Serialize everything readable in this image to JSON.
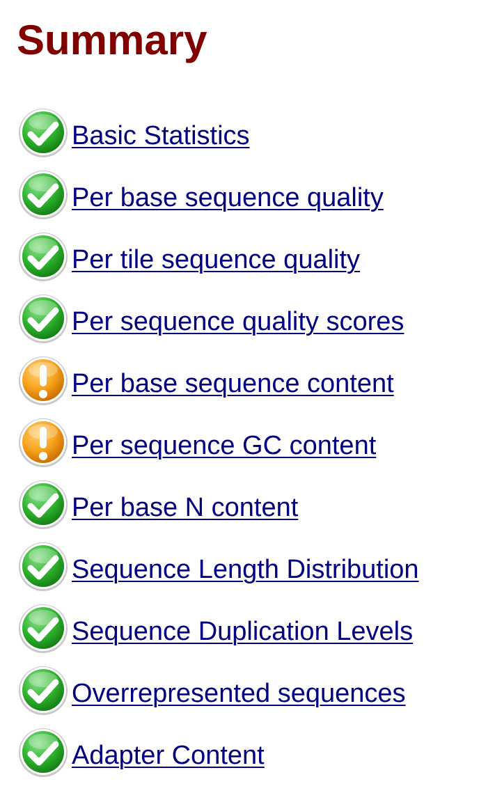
{
  "title": "Summary",
  "modules": [
    {
      "label": "Basic Statistics",
      "status": "pass",
      "icon": "pass-check-icon"
    },
    {
      "label": "Per base sequence quality",
      "status": "pass",
      "icon": "pass-check-icon"
    },
    {
      "label": "Per tile sequence quality",
      "status": "pass",
      "icon": "pass-check-icon"
    },
    {
      "label": "Per sequence quality scores",
      "status": "pass",
      "icon": "pass-check-icon"
    },
    {
      "label": "Per base sequence content",
      "status": "warn",
      "icon": "warning-exclamation-icon"
    },
    {
      "label": "Per sequence GC content",
      "status": "warn",
      "icon": "warning-exclamation-icon"
    },
    {
      "label": "Per base N content",
      "status": "pass",
      "icon": "pass-check-icon"
    },
    {
      "label": "Sequence Length Distribution",
      "status": "pass",
      "icon": "pass-check-icon"
    },
    {
      "label": "Sequence Duplication Levels",
      "status": "pass",
      "icon": "pass-check-icon"
    },
    {
      "label": "Overrepresented sequences",
      "status": "pass",
      "icon": "pass-check-icon"
    },
    {
      "label": "Adapter Content",
      "status": "pass",
      "icon": "pass-check-icon"
    }
  ],
  "colors": {
    "title": "#800000",
    "link": "#000080",
    "pass": "#22a022",
    "warn": "#f59a00"
  }
}
